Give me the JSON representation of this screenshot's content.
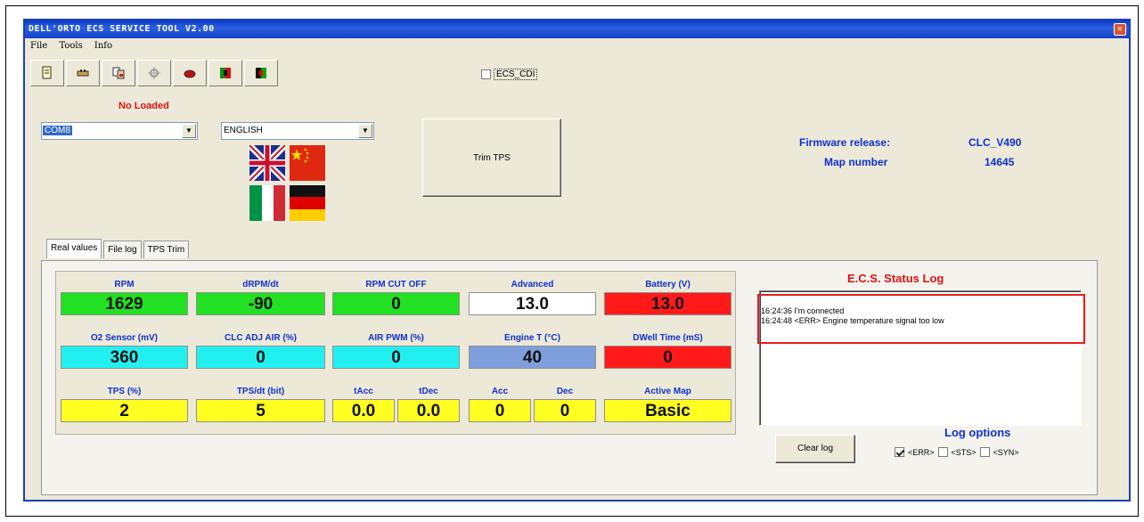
{
  "window": {
    "title": "DELL'ORTO ECS SERVICE TOOL  V2.00"
  },
  "menu": [
    "File",
    "Tools",
    "Info"
  ],
  "toolbar": {
    "icons": [
      "document-icon",
      "connect-plug-icon",
      "copy-icon",
      "gear-icon",
      "motorcycle-icon",
      "red-flag-icon",
      "green-flag-icon"
    ],
    "ecs_checkbox_label": "ECS_CDI",
    "ecs_checked": false
  },
  "status_loaded": "No Loaded",
  "port_select": {
    "value": "COM8"
  },
  "language_select": {
    "value": "ENGLISH"
  },
  "trim_button": "Trim TPS",
  "firmware": {
    "label": "Firmware release:",
    "value": "CLC_V490"
  },
  "map": {
    "label": "Map number",
    "value": "14645"
  },
  "tabs": [
    "Real values",
    "File log",
    "TPS Trim"
  ],
  "gauges": {
    "rpm": {
      "label": "RPM",
      "value": "1629",
      "color": "#22e022"
    },
    "drpm": {
      "label": "dRPM/dt",
      "value": "-90",
      "color": "#22e022"
    },
    "rpm_cut": {
      "label": "RPM CUT OFF",
      "value": "0",
      "color": "#22e022"
    },
    "advanced": {
      "label": "Advanced",
      "value": "13.0",
      "color": "#ffffff"
    },
    "battery": {
      "label": "Battery (V)",
      "value": "13.0",
      "color": "#ff1a1a"
    },
    "o2": {
      "label": "O2 Sensor (mV)",
      "value": "360",
      "color": "#22f0f0"
    },
    "clc_air": {
      "label": "CLC ADJ AIR (%)",
      "value": "0",
      "color": "#22f0f0"
    },
    "air_pwm": {
      "label": "AIR PWM (%)",
      "value": "0",
      "color": "#22f0f0"
    },
    "engine_t": {
      "label": "Engine T (°C)",
      "value": "40",
      "color": "#7f9fdc"
    },
    "dwell": {
      "label": "DWell Time (mS)",
      "value": "0",
      "color": "#ff1a1a"
    },
    "tps": {
      "label": "TPS (%)",
      "value": "2",
      "color": "#ffff22"
    },
    "tps_dt": {
      "label": "TPS/dt (bit)",
      "value": "5",
      "color": "#ffff22"
    },
    "acc_t": {
      "label": "tAcc",
      "value": "0.0"
    },
    "dec_t": {
      "label": "tDec",
      "value": "0.0"
    },
    "acc": {
      "label": "Acc",
      "value": "0"
    },
    "dec": {
      "label": "Dec",
      "value": "0"
    },
    "active_map": {
      "label": "Active Map",
      "value": "Basic"
    }
  },
  "log": {
    "title": "E.C.S. Status Log",
    "lines": [
      "16:24:36  I'm connected",
      "16:24:48  <ERR> Engine temperature signal too low"
    ],
    "clear_button": "Clear log",
    "options_title": "Log options",
    "options": [
      {
        "label": "<ERR>",
        "checked": true
      },
      {
        "label": "<STS>",
        "checked": false
      },
      {
        "label": "<SYN>",
        "checked": false
      }
    ]
  }
}
